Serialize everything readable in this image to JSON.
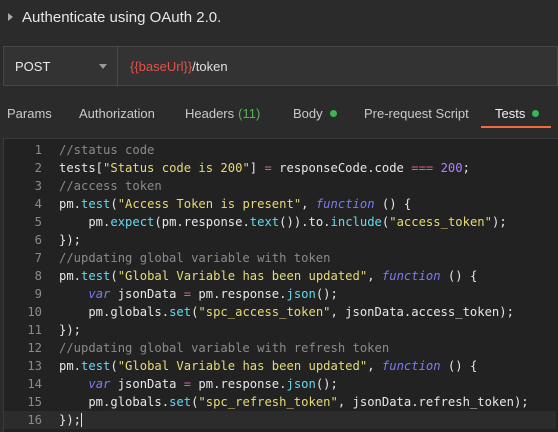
{
  "header": {
    "title": "Authenticate using OAuth 2.0."
  },
  "request": {
    "method": "POST",
    "url_variable": "{{baseUrl}}",
    "url_path": "/token"
  },
  "tabs": [
    {
      "label": "Params"
    },
    {
      "label": "Authorization"
    },
    {
      "label": "Headers",
      "count": "(11)"
    },
    {
      "label": "Body",
      "has_dot": true
    },
    {
      "label": "Pre-request Script"
    },
    {
      "label": "Tests",
      "has_dot": true,
      "active": true
    }
  ],
  "colors": {
    "accent": "#f26b3a",
    "status_dot": "#3bb35a",
    "url_variable": "#e2524a"
  },
  "editor": {
    "lines": [
      {
        "n": "1",
        "segments": [
          {
            "t": "//status code",
            "c": "cm"
          }
        ]
      },
      {
        "n": "2",
        "segments": [
          {
            "t": "tests[",
            "c": "code"
          },
          {
            "t": "\"Status code is 200\"",
            "c": "st"
          },
          {
            "t": "] ",
            "c": "code"
          },
          {
            "t": "=",
            "c": "op"
          },
          {
            "t": " responseCode.code ",
            "c": "code"
          },
          {
            "t": "===",
            "c": "op"
          },
          {
            "t": " ",
            "c": "code"
          },
          {
            "t": "200",
            "c": "num"
          },
          {
            "t": ";",
            "c": "code"
          }
        ]
      },
      {
        "n": "3",
        "segments": [
          {
            "t": "//access token",
            "c": "cm"
          }
        ]
      },
      {
        "n": "4",
        "segments": [
          {
            "t": "pm.",
            "c": "code"
          },
          {
            "t": "test",
            "c": "fn"
          },
          {
            "t": "(",
            "c": "code"
          },
          {
            "t": "\"Access Token is present\"",
            "c": "st"
          },
          {
            "t": ", ",
            "c": "code"
          },
          {
            "t": "function",
            "c": "kw"
          },
          {
            "t": " () {",
            "c": "code"
          }
        ]
      },
      {
        "n": "5",
        "segments": [
          {
            "t": "    pm.",
            "c": "code"
          },
          {
            "t": "expect",
            "c": "fn"
          },
          {
            "t": "(pm.response.",
            "c": "code"
          },
          {
            "t": "text",
            "c": "fn"
          },
          {
            "t": "()).to.",
            "c": "code"
          },
          {
            "t": "include",
            "c": "fn"
          },
          {
            "t": "(",
            "c": "code"
          },
          {
            "t": "\"access_token\"",
            "c": "st"
          },
          {
            "t": ");",
            "c": "code"
          }
        ]
      },
      {
        "n": "6",
        "segments": [
          {
            "t": "});",
            "c": "code"
          }
        ]
      },
      {
        "n": "7",
        "segments": [
          {
            "t": "//updating global variable with token",
            "c": "cm"
          }
        ]
      },
      {
        "n": "8",
        "segments": [
          {
            "t": "pm.",
            "c": "code"
          },
          {
            "t": "test",
            "c": "fn"
          },
          {
            "t": "(",
            "c": "code"
          },
          {
            "t": "\"Global Variable has been updated\"",
            "c": "st"
          },
          {
            "t": ", ",
            "c": "code"
          },
          {
            "t": "function",
            "c": "kw"
          },
          {
            "t": " () {",
            "c": "code"
          }
        ]
      },
      {
        "n": "9",
        "segments": [
          {
            "t": "    ",
            "c": "code"
          },
          {
            "t": "var",
            "c": "kw"
          },
          {
            "t": " jsonData ",
            "c": "code"
          },
          {
            "t": "=",
            "c": "op"
          },
          {
            "t": " pm.response.",
            "c": "code"
          },
          {
            "t": "json",
            "c": "fn"
          },
          {
            "t": "();",
            "c": "code"
          }
        ]
      },
      {
        "n": "10",
        "segments": [
          {
            "t": "    pm.globals.",
            "c": "code"
          },
          {
            "t": "set",
            "c": "fn"
          },
          {
            "t": "(",
            "c": "code"
          },
          {
            "t": "\"spc_access_token\"",
            "c": "st"
          },
          {
            "t": ", jsonData.access_token);",
            "c": "code"
          }
        ]
      },
      {
        "n": "11",
        "segments": [
          {
            "t": "});",
            "c": "code"
          }
        ]
      },
      {
        "n": "12",
        "segments": [
          {
            "t": "//updating global variable with refresh token",
            "c": "cm"
          }
        ]
      },
      {
        "n": "13",
        "segments": [
          {
            "t": "pm.",
            "c": "code"
          },
          {
            "t": "test",
            "c": "fn"
          },
          {
            "t": "(",
            "c": "code"
          },
          {
            "t": "\"Global Variable has been updated\"",
            "c": "st"
          },
          {
            "t": ", ",
            "c": "code"
          },
          {
            "t": "function",
            "c": "kw"
          },
          {
            "t": " () {",
            "c": "code"
          }
        ]
      },
      {
        "n": "14",
        "segments": [
          {
            "t": "    ",
            "c": "code"
          },
          {
            "t": "var",
            "c": "kw"
          },
          {
            "t": " jsonData ",
            "c": "code"
          },
          {
            "t": "=",
            "c": "op"
          },
          {
            "t": " pm.response.",
            "c": "code"
          },
          {
            "t": "json",
            "c": "fn"
          },
          {
            "t": "();",
            "c": "code"
          }
        ]
      },
      {
        "n": "15",
        "segments": [
          {
            "t": "    pm.globals.",
            "c": "code"
          },
          {
            "t": "set",
            "c": "fn"
          },
          {
            "t": "(",
            "c": "code"
          },
          {
            "t": "\"spc_refresh_token\"",
            "c": "st"
          },
          {
            "t": ", jsonData.refresh_token);",
            "c": "code"
          }
        ]
      },
      {
        "n": "16",
        "segments": [
          {
            "t": "});",
            "c": "code"
          }
        ],
        "current": true
      }
    ]
  }
}
